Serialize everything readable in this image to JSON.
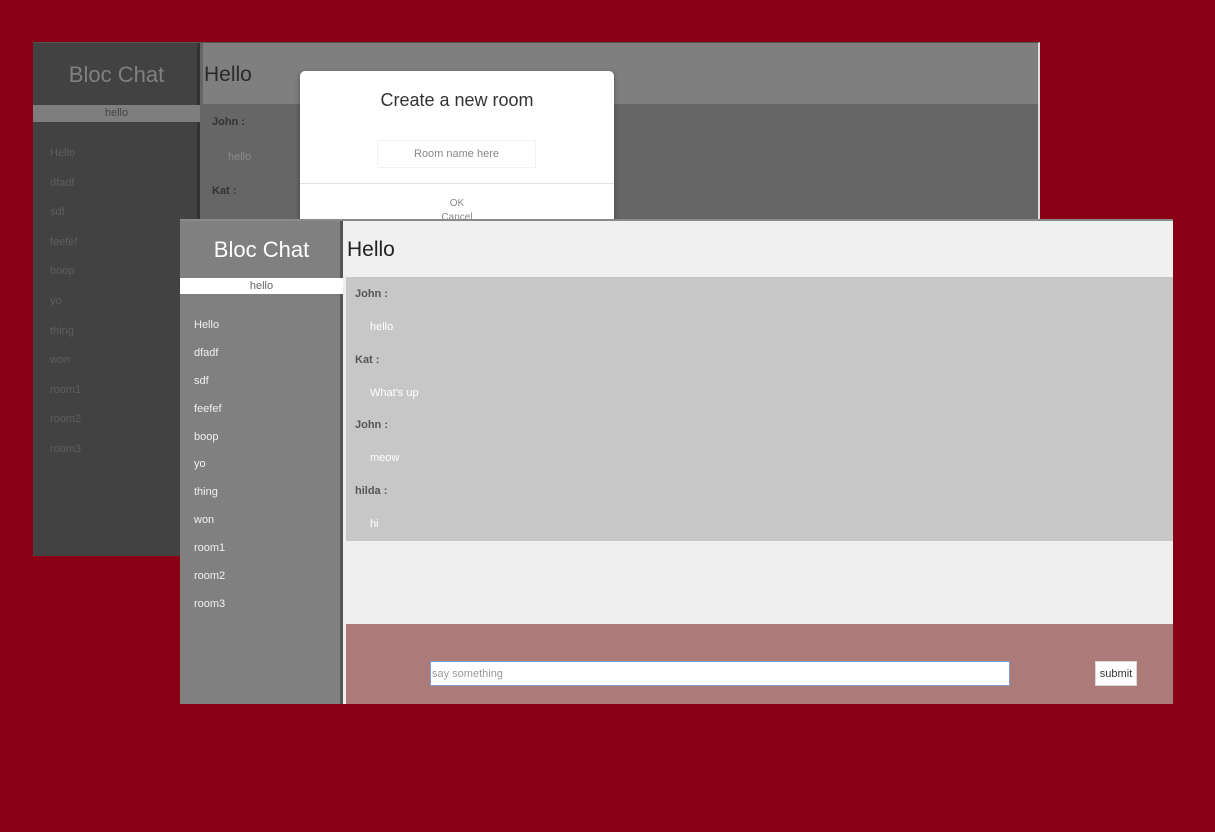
{
  "back_window": {
    "brand": "Bloc Chat",
    "user": "hello",
    "rooms": [
      "Hello",
      "dfadf",
      "sdf",
      "feefef",
      "boop",
      "yo",
      "thing",
      "won",
      "room1",
      "room2",
      "room3"
    ],
    "room_title": "Hello",
    "messages": [
      {
        "user": "John :",
        "text": "hello"
      },
      {
        "user": "Kat :",
        "text": ""
      }
    ]
  },
  "modal": {
    "title": "Create a new room",
    "input_placeholder": "Room name here",
    "ok_label": "OK",
    "cancel_label": "Cancel"
  },
  "front_window": {
    "brand": "Bloc Chat",
    "user": "hello",
    "rooms": [
      "Hello",
      "dfadf",
      "sdf",
      "feefef",
      "boop",
      "yo",
      "thing",
      "won",
      "room1",
      "room2",
      "room3"
    ],
    "room_title": "Hello",
    "messages": [
      {
        "user": "John :",
        "text": "hello"
      },
      {
        "user": "Kat :",
        "text": "What's up"
      },
      {
        "user": "John :",
        "text": "meow"
      },
      {
        "user": "hilda :",
        "text": "hi"
      }
    ],
    "composer": {
      "placeholder": "say something",
      "submit_label": "submit"
    }
  },
  "colors": {
    "page_background": "#8a0014",
    "sidebar": "#808080",
    "messages_background": "#c7c7c7",
    "composer_background": "#ad7a7a"
  }
}
